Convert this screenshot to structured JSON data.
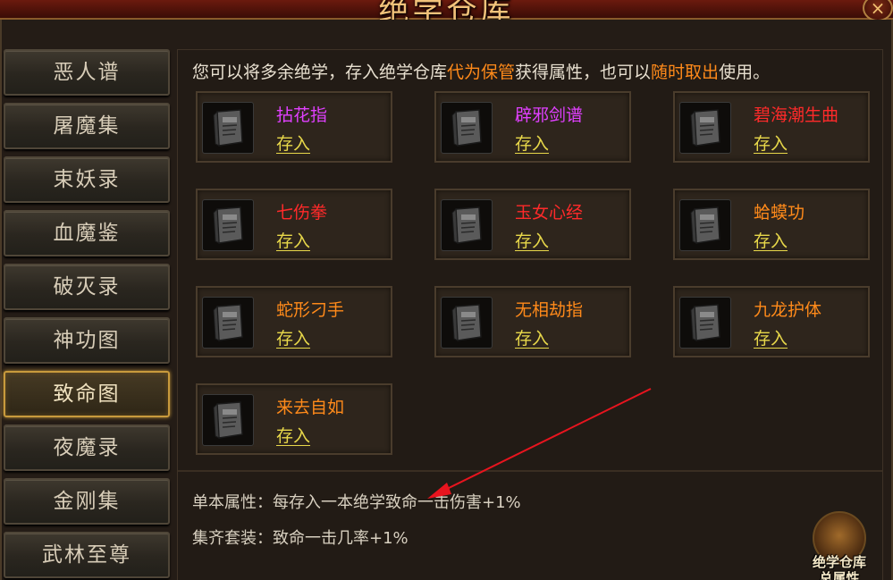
{
  "window": {
    "title": "绝学仓库",
    "close_label": "×"
  },
  "sidebar": {
    "items": [
      {
        "label": "恶人谱",
        "active": false
      },
      {
        "label": "屠魔集",
        "active": false
      },
      {
        "label": "束妖录",
        "active": false
      },
      {
        "label": "血魔鉴",
        "active": false
      },
      {
        "label": "破灭录",
        "active": false
      },
      {
        "label": "神功图",
        "active": false
      },
      {
        "label": "致命图",
        "active": true
      },
      {
        "label": "夜魔录",
        "active": false
      },
      {
        "label": "金刚集",
        "active": false
      },
      {
        "label": "武林至尊",
        "active": false
      }
    ]
  },
  "main": {
    "intro": {
      "part1": "您可以将多余绝学，存入绝学仓库",
      "highlight1": "代为保管",
      "part2": "获得属性，也可以",
      "highlight2": "随时取出",
      "part3": "使用。"
    },
    "cards": [
      {
        "name": "拈花指",
        "color": "#e040ff",
        "action": "存入"
      },
      {
        "name": "辟邪剑谱",
        "color": "#e040ff",
        "action": "存入"
      },
      {
        "name": "碧海潮生曲",
        "color": "#ff2a2a",
        "action": "存入"
      },
      {
        "name": "七伤拳",
        "color": "#ff2a2a",
        "action": "存入"
      },
      {
        "name": "玉女心经",
        "color": "#ff2a2a",
        "action": "存入"
      },
      {
        "name": "蛤蟆功",
        "color": "#ff8a1a",
        "action": "存入"
      },
      {
        "name": "蛇形刁手",
        "color": "#ff8a1a",
        "action": "存入"
      },
      {
        "name": "无相劫指",
        "color": "#ff8a1a",
        "action": "存入"
      },
      {
        "name": "九龙护体",
        "color": "#ff8a1a",
        "action": "存入"
      },
      {
        "name": "来去自如",
        "color": "#ff8a1a",
        "action": "存入"
      }
    ],
    "single_attr": "单本属性：每存入一本绝学致命一击伤害+1%",
    "set_attr": "集齐套装：致命一击几率+1%",
    "summary_button": {
      "line1": "绝学仓库",
      "line2": "总属性"
    }
  },
  "colors": {
    "accent_orange": "#ff8a1a",
    "deposit_yellow": "#e8d84a",
    "active_border": "#c89a3c",
    "arrow_red": "#e8141e"
  }
}
